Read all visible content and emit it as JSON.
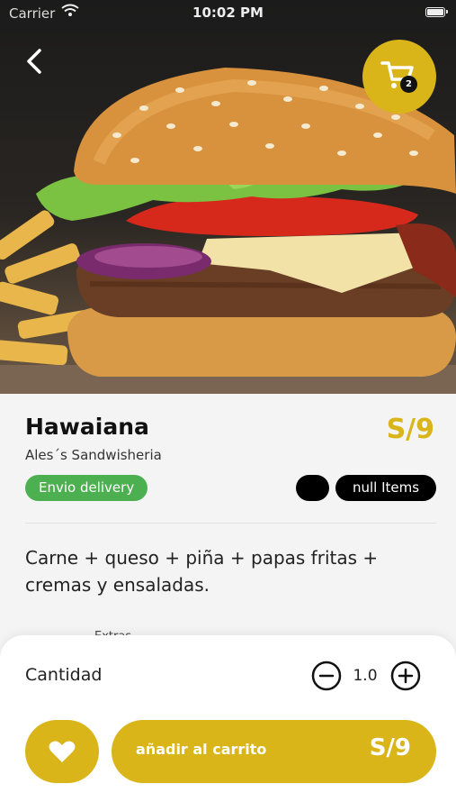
{
  "status_bar": {
    "carrier": "Carrier",
    "time": "10:02 PM"
  },
  "header": {
    "back_icon": "chevron-left-icon",
    "cart_icon": "shopping-cart-icon",
    "cart_count": "2"
  },
  "product": {
    "name": "Hawaiana",
    "price": "S/9",
    "store": "Ales´s Sandwisheria",
    "delivery_badge": "Envio delivery",
    "items_badge": "null Items",
    "description": "Carne + queso + piña + papas fritas + cremas y ensaladas.",
    "peek_label": "Extras"
  },
  "order": {
    "quantity_label": "Cantidad",
    "quantity_value": "1.0",
    "add_to_cart_label": "añadir al carrito",
    "add_to_cart_price": "S/9",
    "favorite_icon": "heart-icon"
  },
  "colors": {
    "accent": "#d9b51a",
    "delivery_green": "#4caf50",
    "badge_black": "#000000"
  }
}
